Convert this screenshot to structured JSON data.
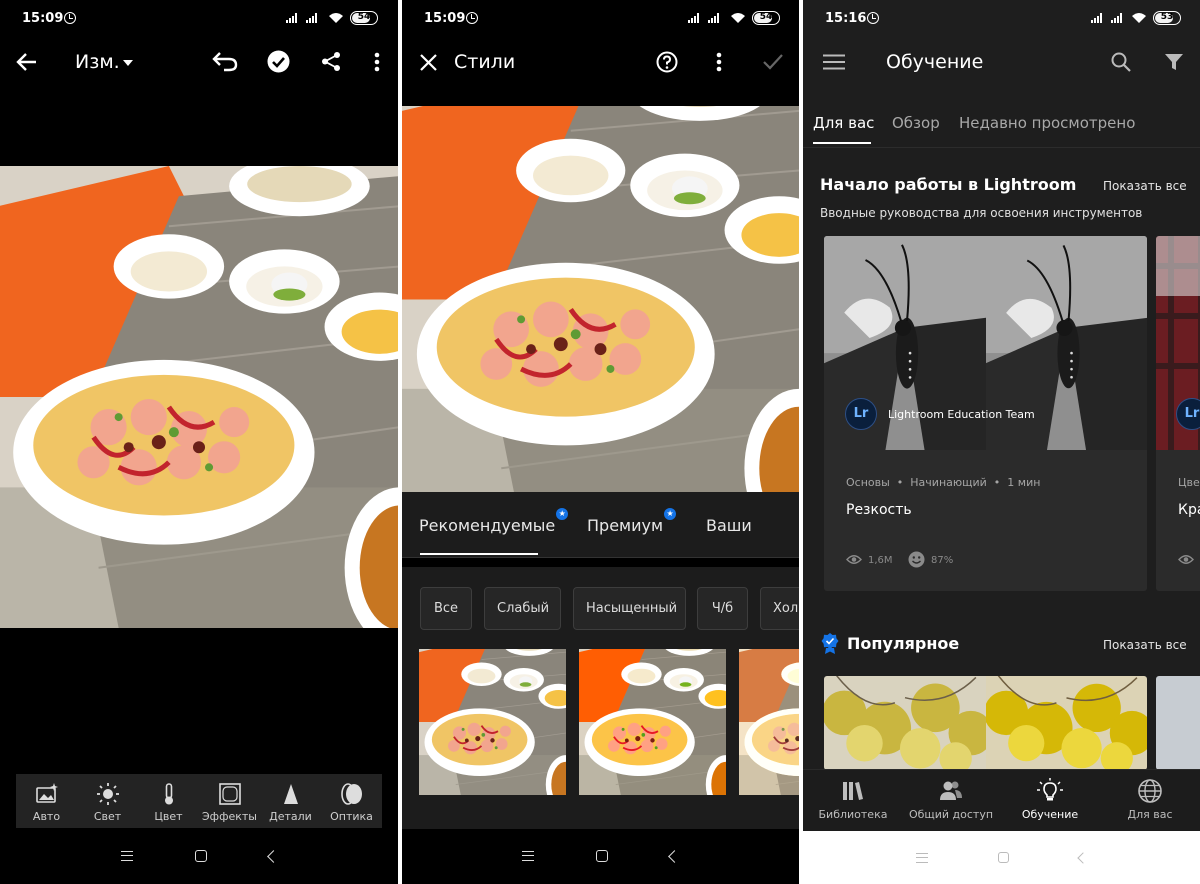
{
  "panel_edit": {
    "status_time": "15:09",
    "battery": "54",
    "title": "Изм.",
    "tools": [
      {
        "icon": "auto-icon",
        "label": "Авто"
      },
      {
        "icon": "light-icon",
        "label": "Свет"
      },
      {
        "icon": "color-icon",
        "label": "Цвет"
      },
      {
        "icon": "effects-icon",
        "label": "Эффекты"
      },
      {
        "icon": "details-icon",
        "label": "Детали"
      },
      {
        "icon": "optics-icon",
        "label": "Оптика"
      }
    ]
  },
  "panel_presets": {
    "status_time": "15:09",
    "battery": "54",
    "title": "Стили",
    "tabs": [
      {
        "label": "Рекомендуемые",
        "badge": "★"
      },
      {
        "label": "Премиум",
        "badge": "★"
      },
      {
        "label": "Ваши",
        "badge": ""
      }
    ],
    "chips": [
      "Все",
      "Слабый",
      "Насыщенный",
      "Ч/б",
      "Хол"
    ]
  },
  "panel_learn": {
    "status_time": "15:16",
    "battery": "53",
    "title": "Обучение",
    "tabs": [
      "Для вас",
      "Обзор",
      "Недавно просмотрено"
    ],
    "section1": {
      "title": "Начало работы в Lightroom",
      "subtitle": "Вводные руководства для освоения инструментов",
      "show_all": "Показать все",
      "card": {
        "author": "Lightroom Education Team",
        "avatar": "Lr",
        "meta_level": "Основы",
        "meta_skill": "Начинающий",
        "meta_time": "1 мин",
        "title": "Резкость",
        "views": "1,6M",
        "rating": "87%"
      },
      "card2": {
        "avatar": "Lr",
        "meta_cut": "Цве",
        "title_cut": "Кра"
      }
    },
    "section2": {
      "title": "Популярное",
      "show_all": "Показать все"
    },
    "bottom_nav": [
      {
        "icon": "library-icon",
        "label": "Библиотека"
      },
      {
        "icon": "sharing-icon",
        "label": "Общий доступ"
      },
      {
        "icon": "learn-icon",
        "label": "Обучение"
      },
      {
        "icon": "globe-icon",
        "label": "Для вас"
      }
    ]
  },
  "colors": {
    "accent": "#1473e6",
    "bg_dark": "#1e1e1e"
  }
}
